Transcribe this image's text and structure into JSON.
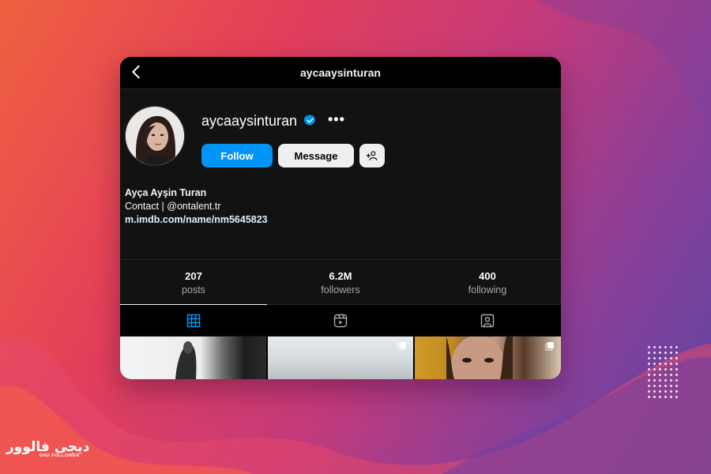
{
  "header": {
    "title": "aycaaysinturan"
  },
  "profile": {
    "username": "aycaaysinturan",
    "verified": true,
    "follow_label": "Follow",
    "message_label": "Message",
    "bio": {
      "name": "Ayça Ayşin Turan",
      "line": "Contact | @ontalent.tr",
      "link": "m.imdb.com/name/nm5645823"
    }
  },
  "stats": [
    {
      "value": "207",
      "label": "posts"
    },
    {
      "value": "6.2M",
      "label": "followers"
    },
    {
      "value": "400",
      "label": "following"
    }
  ],
  "tabs": [
    {
      "icon": "grid-icon",
      "active": true
    },
    {
      "icon": "reels-icon",
      "active": false
    },
    {
      "icon": "tagged-icon",
      "active": false
    }
  ],
  "posts": [
    {
      "icon": "none"
    },
    {
      "icon": "carousel-icon"
    },
    {
      "icon": "carousel-icon"
    }
  ],
  "watermark": {
    "arabic": "دیجی فالوور",
    "english": "DIGI FOLLOWER"
  },
  "colors": {
    "accent": "#0095f6",
    "background": "#121212",
    "verified": "#0095f6"
  }
}
